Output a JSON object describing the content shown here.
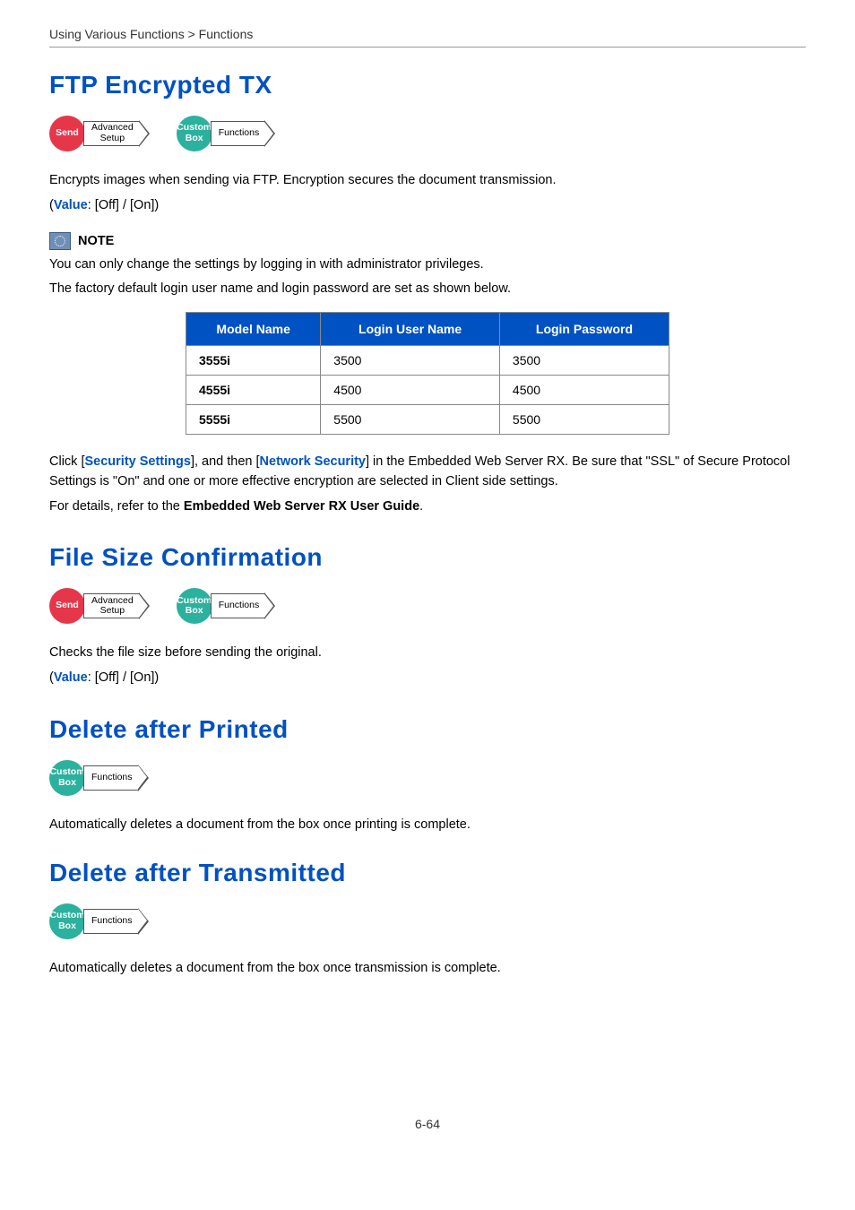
{
  "breadcrumb": "Using Various Functions > Functions",
  "footer": "6-64",
  "badges": {
    "send": "Send",
    "custom_box": "Custom\nBox",
    "advanced_setup": "Advanced\nSetup",
    "functions": "Functions"
  },
  "note": {
    "label": "NOTE"
  },
  "sections": {
    "ftp": {
      "title": "FTP Encrypted TX",
      "desc": "Encrypts images when sending via FTP. Encryption secures the document transmission.",
      "value_prefix": "(",
      "value_label": "Value",
      "value_suffix": ": [Off] / [On])",
      "note1": "You can only change the settings by logging in with administrator privileges.",
      "note2": "The factory default login user name and login password are set as shown below.",
      "table": {
        "headers": [
          "Model Name",
          "Login User Name",
          "Login Password"
        ],
        "rows": [
          [
            "3555i",
            "3500",
            "3500"
          ],
          [
            "4555i",
            "4500",
            "4500"
          ],
          [
            "5555i",
            "5500",
            "5500"
          ]
        ]
      },
      "after_table_1a": "Click [",
      "after_table_1b": "Security Settings",
      "after_table_1c": "], and then [",
      "after_table_1d": "Network Security",
      "after_table_1e": "] in the Embedded Web Server RX. Be sure that \"SSL\" of Secure Protocol Settings is \"On\" and one or more effective encryption are selected in Client side settings.",
      "after_table_2a": "For details, refer to the ",
      "after_table_2b": "Embedded Web Server RX User Guide",
      "after_table_2c": "."
    },
    "filesize": {
      "title": "File Size Confirmation",
      "desc": "Checks the file size before sending the original.",
      "value_prefix": "(",
      "value_label": "Value",
      "value_suffix": ": [Off] / [On])"
    },
    "del_printed": {
      "title": "Delete after Printed",
      "desc": "Automatically deletes a document from the box once printing is complete."
    },
    "del_transmitted": {
      "title": "Delete after Transmitted",
      "desc": "Automatically deletes a document from the box once transmission is complete."
    }
  }
}
